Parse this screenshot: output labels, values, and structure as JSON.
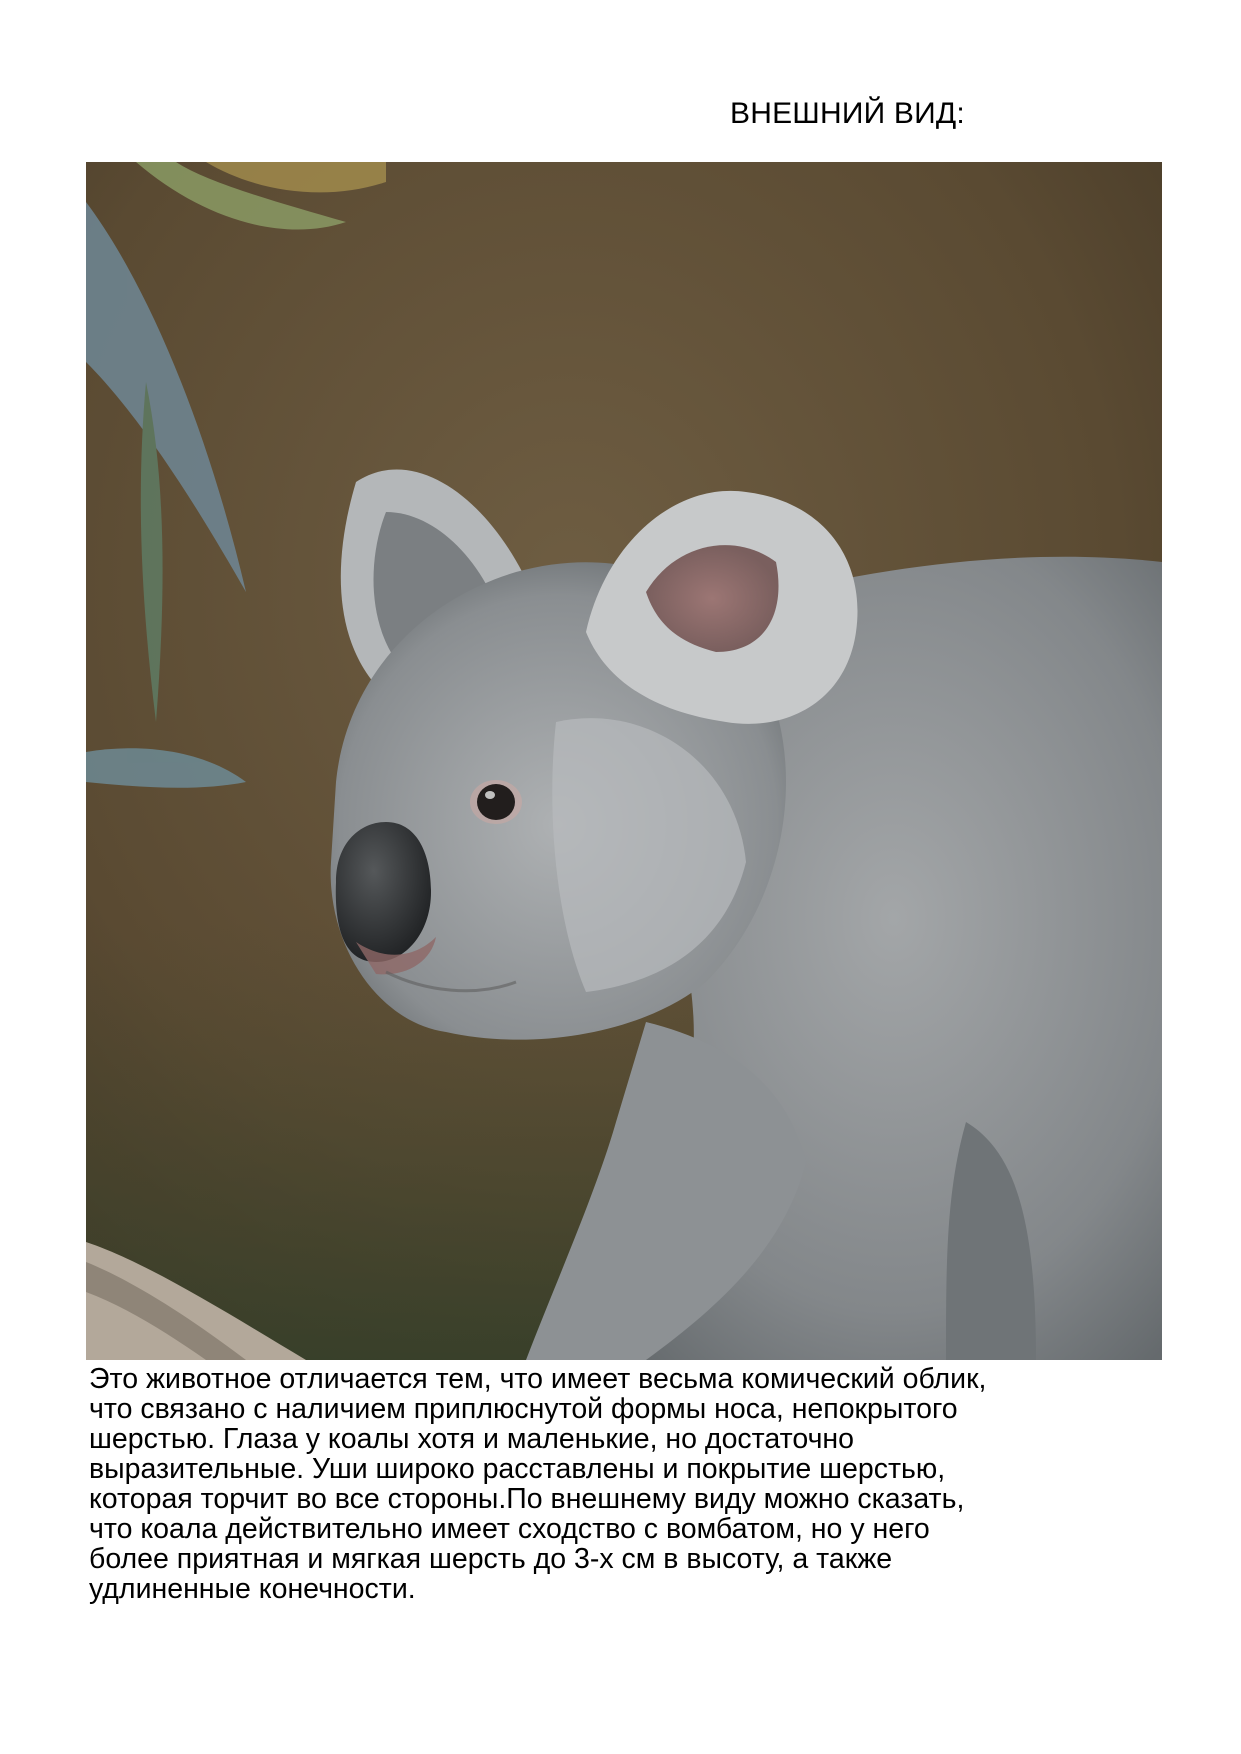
{
  "heading": "ВНЕШНИЙ ВИД:",
  "photo": {
    "subject": "koala"
  },
  "paragraph": {
    "lines": [
      "Это животное отличается тем, что имеет весьма комический облик,",
      "что связано с наличием приплюснутой формы носа, непокрытого",
      "шерстью. Глаза у коалы хотя и маленькие, но достаточно",
      "выразительные. Уши широко расставлены и покрытие шерстью,",
      "которая торчит во все стороны.По внешнему виду можно сказать,",
      "что коала действительно имеет сходство с вомбатом, но у него",
      "более приятная и мягкая шерсть до 3-х см в высоту, а также",
      "удлиненные конечности."
    ]
  }
}
